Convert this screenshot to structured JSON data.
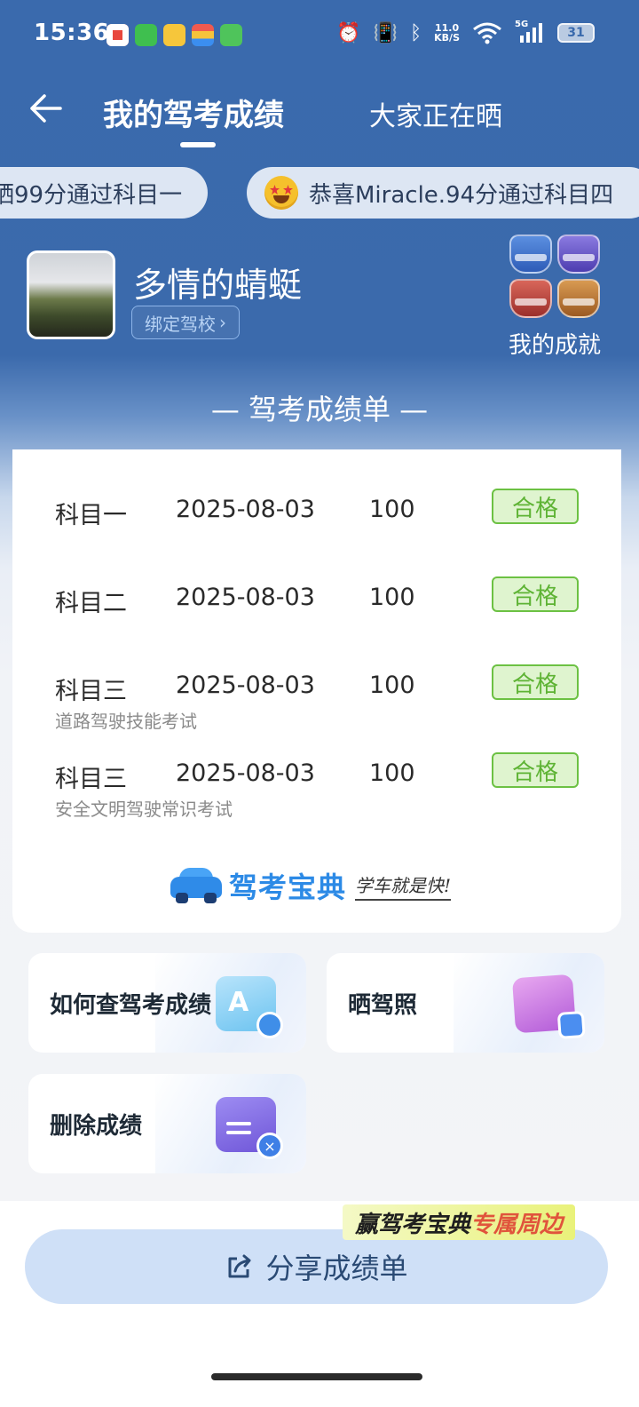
{
  "status_bar": {
    "time": "15:36",
    "net_speed_value": "11.0",
    "net_speed_unit": "KB/S",
    "signal": "5G",
    "battery": "31"
  },
  "nav": {
    "tab_active": "我的驾考成绩",
    "tab_other": "大家正在晒"
  },
  "marquee": [
    "晒99分通过科目一",
    "恭喜Miracle.94分通过科目四"
  ],
  "profile": {
    "username": "多情的蜻蜓",
    "bind_school": "绑定驾校",
    "achievements_label": "我的成就"
  },
  "sheet": {
    "title": "— 驾考成绩单 —",
    "rows": [
      {
        "subject": "科目一",
        "date": "2025-08-03",
        "score": "100",
        "status": "合格",
        "sub": ""
      },
      {
        "subject": "科目二",
        "date": "2025-08-03",
        "score": "100",
        "status": "合格",
        "sub": ""
      },
      {
        "subject": "科目三",
        "date": "2025-08-03",
        "score": "100",
        "status": "合格",
        "sub": "道路驾驶技能考试"
      },
      {
        "subject": "科目三",
        "date": "2025-08-03",
        "score": "100",
        "status": "合格",
        "sub": "安全文明驾驶常识考试"
      }
    ],
    "brand_name": "驾考宝典",
    "brand_slogan": "学车就是快!"
  },
  "actions": {
    "query": "如何查驾考成绩",
    "show_license": "晒驾照",
    "delete": "删除成绩"
  },
  "promo": {
    "part1": "赢驾考宝典",
    "part2": "专属周边"
  },
  "share_button": "分享成绩单",
  "colors": {
    "header_blue": "#3a6aad",
    "pass_green": "#6cc143",
    "brand_blue": "#2c8ae6"
  }
}
